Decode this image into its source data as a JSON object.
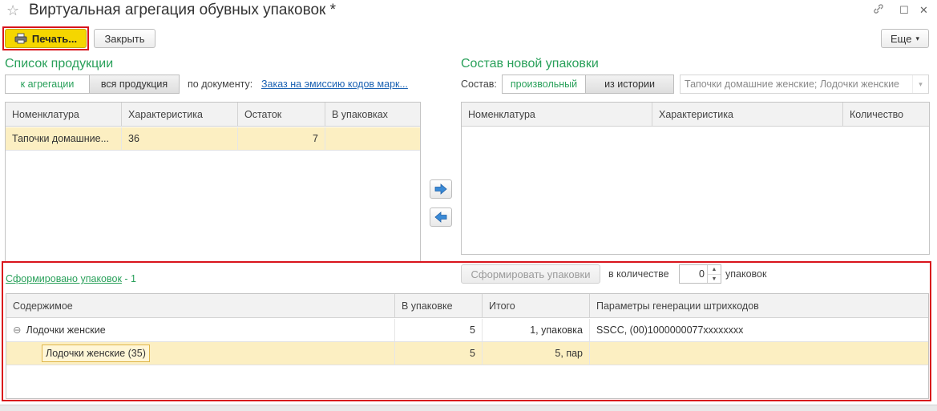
{
  "window": {
    "title": "Виртуальная агрегация обувных упаковок *",
    "star_icon": "☆",
    "link_icon": "🔗",
    "maximize_icon": "☐",
    "close_icon": "✕"
  },
  "toolbar": {
    "print_label": "Печать...",
    "close_label": "Закрыть",
    "more_label": "Еще",
    "more_arrow": "▾"
  },
  "products": {
    "title": "Список продукции",
    "toggle_aggregation": "к агрегации",
    "toggle_all": "вся продукция",
    "by_document_label": "по документу:",
    "document_link": "Заказ на эмиссию кодов марк...",
    "columns": [
      "Номенклатура",
      "Характеристика",
      "Остаток",
      "В упаковках"
    ],
    "rows": [
      {
        "name": "Тапочки домашние...",
        "characteristic": "36",
        "remaining": "7",
        "in_packages": ""
      }
    ]
  },
  "new_package": {
    "title": "Состав новой упаковки",
    "composition_label": "Состав:",
    "toggle_arbitrary": "произвольный",
    "toggle_history": "из истории",
    "history_select": "Тапочки домашние женские; Лодочки женские",
    "history_select_arrow": "▾",
    "columns": [
      "Номенклатура",
      "Характеристика",
      "Количество"
    ]
  },
  "formed": {
    "link_text": "Сформировано упаковок",
    "count_suffix": " - 1",
    "form_button": "Сформировать упаковки",
    "quantity_label": "в количестве",
    "quantity_value": "0",
    "packages_label": "упаковок",
    "columns": [
      "Содержимое",
      "В упаковке",
      "Итого",
      "Параметры генерации штрихкодов"
    ],
    "rows": [
      {
        "expand_icon": "⊖",
        "content": "Лодочки женские",
        "in_package": "5",
        "total": "1, упаковка",
        "params": "SSCC, (00)1000000077xxxxxxxx"
      },
      {
        "content": "Лодочки женские (35)",
        "in_package": "5",
        "total": "5, пар",
        "params": ""
      }
    ]
  },
  "colors": {
    "accent_green": "#29a05a",
    "print_yellow": "#f5d600",
    "highlight_red": "#d9141c",
    "selection": "#fcefc2",
    "link_blue": "#1b62b3"
  }
}
